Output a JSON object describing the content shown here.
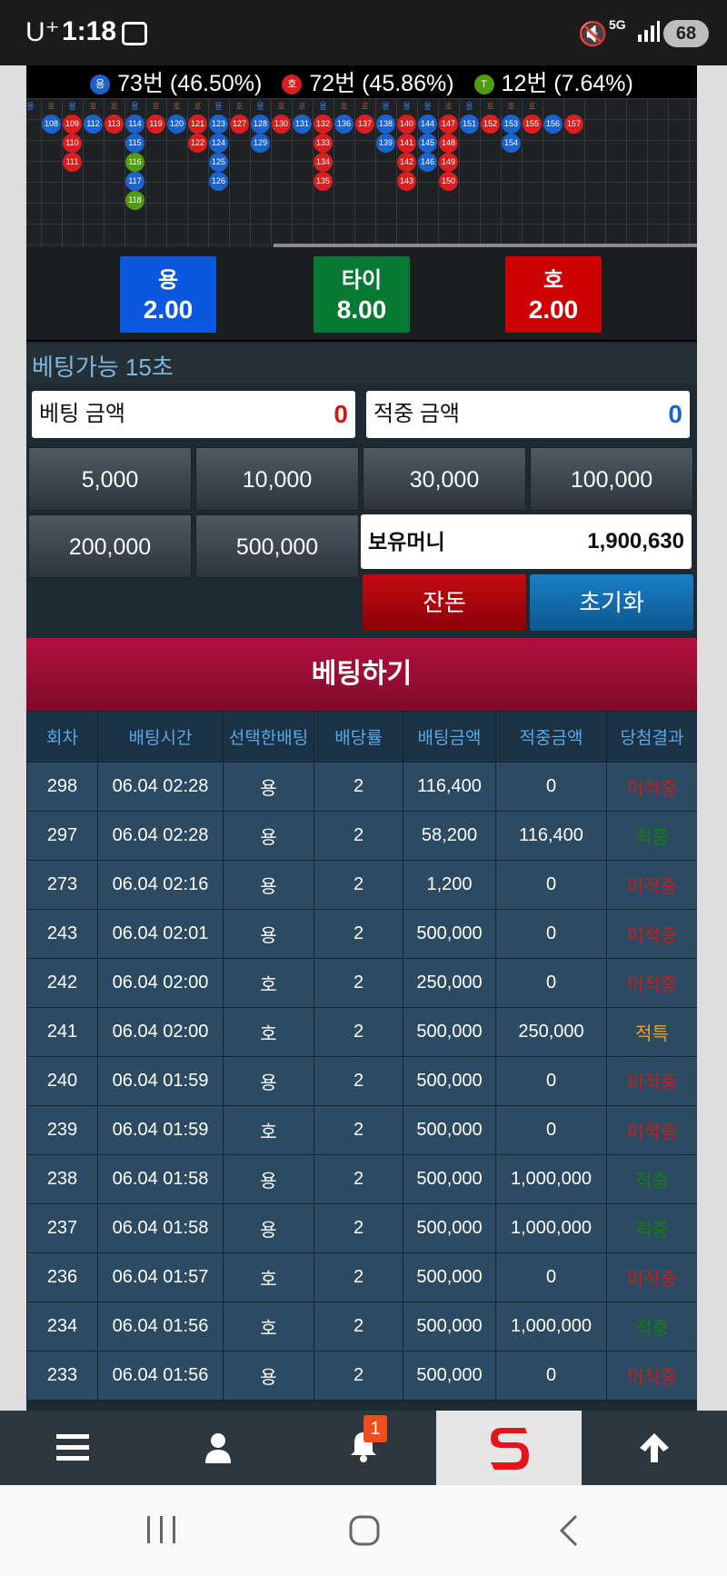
{
  "status_bar": {
    "carrier": "U⁺",
    "time": "1:18",
    "network": "5G",
    "battery": "68"
  },
  "stats": {
    "dragon": {
      "icon": "용",
      "text": "73번 (46.50%)"
    },
    "tiger": {
      "icon": "호",
      "text": "72번 (45.86%)"
    },
    "tie": {
      "icon": "T",
      "text": "12번 (7.64%)"
    }
  },
  "odds": {
    "dragon": {
      "name": "용",
      "value": "2.00",
      "color": "#0b58df"
    },
    "tie": {
      "name": "타이",
      "value": "8.00",
      "color": "#067a35"
    },
    "tiger": {
      "name": "호",
      "value": "2.00",
      "color": "#cc0202"
    }
  },
  "betting": {
    "timer": "베팅가능 15초",
    "bet_amount_label": "베팅 금액",
    "bet_amount_value": "0",
    "win_amount_label": "적중 금액",
    "win_amount_value": "0",
    "chips": [
      "5,000",
      "10,000",
      "30,000",
      "100,000",
      "200,000",
      "500,000"
    ],
    "money_label": "보유머니",
    "money_value": "1,900,630",
    "change_label": "잔돈",
    "reset_label": "초기화",
    "bet_button": "베팅하기"
  },
  "history": {
    "headers": [
      "회차",
      "배팅시간",
      "선택한배팅",
      "배당률",
      "배팅금액",
      "적중금액",
      "당첨결과"
    ],
    "rows": [
      {
        "round": "298",
        "time": "06.04 02:28",
        "pick": "용",
        "odds": "2",
        "bet": "116,400",
        "win": "0",
        "result": "미적중"
      },
      {
        "round": "297",
        "time": "06.04 02:28",
        "pick": "용",
        "odds": "2",
        "bet": "58,200",
        "win": "116,400",
        "result": "적중"
      },
      {
        "round": "273",
        "time": "06.04 02:16",
        "pick": "용",
        "odds": "2",
        "bet": "1,200",
        "win": "0",
        "result": "미적중"
      },
      {
        "round": "243",
        "time": "06.04 02:01",
        "pick": "용",
        "odds": "2",
        "bet": "500,000",
        "win": "0",
        "result": "미적중"
      },
      {
        "round": "242",
        "time": "06.04 02:00",
        "pick": "호",
        "odds": "2",
        "bet": "250,000",
        "win": "0",
        "result": "미적중"
      },
      {
        "round": "241",
        "time": "06.04 02:00",
        "pick": "호",
        "odds": "2",
        "bet": "500,000",
        "win": "250,000",
        "result": "적특"
      },
      {
        "round": "240",
        "time": "06.04 01:59",
        "pick": "용",
        "odds": "2",
        "bet": "500,000",
        "win": "0",
        "result": "미적중"
      },
      {
        "round": "239",
        "time": "06.04 01:59",
        "pick": "호",
        "odds": "2",
        "bet": "500,000",
        "win": "0",
        "result": "미적중"
      },
      {
        "round": "238",
        "time": "06.04 01:58",
        "pick": "용",
        "odds": "2",
        "bet": "500,000",
        "win": "1,000,000",
        "result": "적중"
      },
      {
        "round": "237",
        "time": "06.04 01:58",
        "pick": "용",
        "odds": "2",
        "bet": "500,000",
        "win": "1,000,000",
        "result": "적중"
      },
      {
        "round": "236",
        "time": "06.04 01:57",
        "pick": "호",
        "odds": "2",
        "bet": "500,000",
        "win": "0",
        "result": "미적중"
      },
      {
        "round": "234",
        "time": "06.04 01:56",
        "pick": "호",
        "odds": "2",
        "bet": "500,000",
        "win": "1,000,000",
        "result": "적중"
      },
      {
        "round": "233",
        "time": "06.04 01:56",
        "pick": "용",
        "odds": "2",
        "bet": "500,000",
        "win": "0",
        "result": "미적중"
      }
    ]
  },
  "roadmap": {
    "header_marks": [
      "용",
      "호",
      "용",
      "호",
      "호",
      "용",
      "호",
      "호",
      "호",
      "용",
      "호",
      "용",
      "호",
      "호",
      "용",
      "호",
      "호",
      "용",
      "용",
      "용",
      "호",
      "용",
      "호",
      "호",
      "호"
    ],
    "columns": [
      [
        "b:108"
      ],
      [
        "r:109",
        "r:110",
        "r:111"
      ],
      [
        "b:112"
      ],
      [
        "r:113"
      ],
      [
        "b:114",
        "b:115",
        "g:116",
        "b:117",
        "g:118"
      ],
      [
        "r:119"
      ],
      [
        "b:120"
      ],
      [
        "r:121",
        "r:122"
      ],
      [
        "b:123",
        "b:124",
        "b:125",
        "b:126"
      ],
      [
        "r:127"
      ],
      [
        "b:128",
        "b:129"
      ],
      [
        "r:130"
      ],
      [
        "b:131"
      ],
      [
        "r:132",
        "r:133",
        "r:134",
        "r:135"
      ],
      [
        "b:136"
      ],
      [
        "r:137"
      ],
      [
        "b:138",
        "b:139"
      ],
      [
        "r:140",
        "r:141",
        "r:142",
        "r:143"
      ],
      [
        "b:144",
        "b:145",
        "b:146"
      ],
      [
        "r:147",
        "r:148",
        "r:149",
        "r:150"
      ],
      [
        "b:151"
      ],
      [
        "r:152"
      ],
      [
        "b:153",
        "b:154"
      ],
      [
        "r:155"
      ],
      [
        "b:156"
      ],
      [
        "r:157"
      ]
    ]
  },
  "tabs": {
    "notification_count": "1"
  }
}
